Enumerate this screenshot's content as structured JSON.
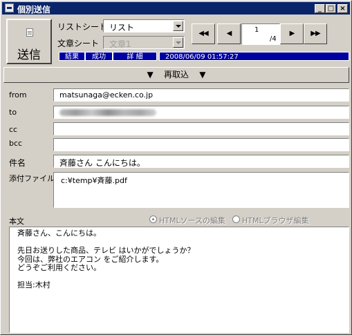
{
  "window": {
    "title": "個別送信"
  },
  "toolbar": {
    "send_label": "送信",
    "list_sheet_label": "リストシート",
    "list_sheet_value": "リスト",
    "doc_sheet_label": "文章シート",
    "doc_sheet_value": "文章1",
    "page_current": "1",
    "page_total": "/4"
  },
  "status": {
    "tabs": [
      "結果",
      "成功",
      "詳 細"
    ],
    "timestamp": "2008/06/09 01:57:27"
  },
  "reacquire_label": "再取込",
  "fields": {
    "from_label": "from",
    "from_value": "matsunaga@ecken.co.jp",
    "to_label": "to",
    "cc_label": "cc",
    "bcc_label": "bcc",
    "subject_label": "件名",
    "subject_value": "斉藤さん こんにちは。",
    "attachment_label": "添付ファイル",
    "attachment_value": "c:¥temp¥斉藤.pdf"
  },
  "body": {
    "label": "本文",
    "radio_source": "HTMLソースの編集",
    "radio_browser": "HTMLブラウザ編集",
    "text": "斉藤さん、こんにちは。\n\n先日お送りした商品、テレビ はいかがでしょうか？\n今回は、弊社のエアコン をご紹介します。\nどうぞご利用ください。\n\n担当:木村"
  }
}
